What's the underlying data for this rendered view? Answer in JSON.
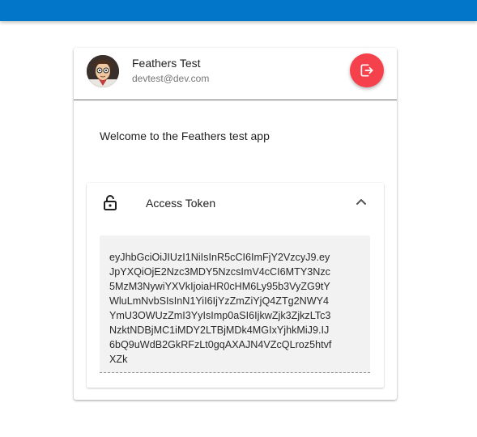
{
  "app": {
    "accent_color": "#0277c9",
    "danger_color": "#f5414b"
  },
  "user": {
    "name": "Feathers Test",
    "email": "devtest@dev.com",
    "avatar_icon": "cartoon-avatar"
  },
  "header": {
    "logout_icon": "logout-icon"
  },
  "main": {
    "welcome_text": "Welcome to the Feathers test app"
  },
  "token_panel": {
    "title": "Access Token",
    "icon": "lock-open-icon",
    "expanded": true,
    "token_lines": "eyJhbGciOiJIUzI1NiIsInR5cCI6ImFjY2VzcyJ9.ey\nJpYXQiOjE2Nzc3MDY5NzcsImV4cCI6MTY3Nzc\n5MzM3NywiYXVkIjoiaHR0cHM6Ly95b3VyZG9tY\nWluLmNvbSIsInN1YiI6IjYzZmZiYjQ4ZTg2NWY4\nYmU3OWUzZmI3YyIsImp0aSI6IjkwZjk3ZjkzLTc3\nNzktNDBjMC1iMDY2LTBjMDk4MGIxYjhkMiJ9.IJ\n6bQ9uWdB2GkRFzLt0gqAXAJN4VZcQLroz5htvf\nXZk"
  }
}
